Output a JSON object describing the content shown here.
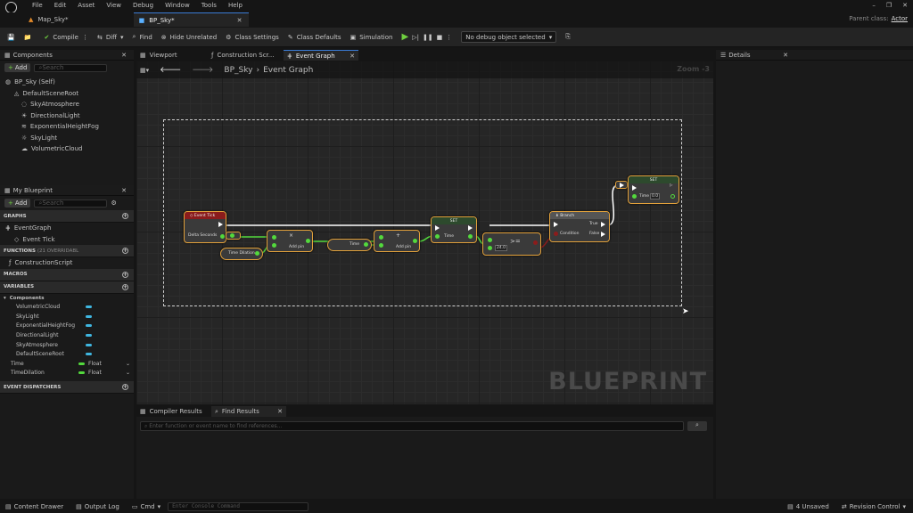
{
  "menu": [
    "File",
    "Edit",
    "Asset",
    "View",
    "Debug",
    "Window",
    "Tools",
    "Help"
  ],
  "tabs": [
    {
      "label": "Map_Sky*"
    },
    {
      "label": "BP_Sky*"
    }
  ],
  "parent_class_label": "Parent class:",
  "parent_class": "Actor",
  "toolbar": {
    "compile": "Compile",
    "diff": "Diff",
    "find": "Find",
    "hide_unrelated": "Hide Unrelated",
    "class_settings": "Class Settings",
    "class_defaults": "Class Defaults",
    "simulation": "Simulation",
    "debug_object": "No debug object selected"
  },
  "components_panel": {
    "title": "Components",
    "add": "Add",
    "search": "Search",
    "items": [
      {
        "label": "BP_Sky (Self)"
      },
      {
        "label": "DefaultSceneRoot"
      },
      {
        "label": "SkyAtmosphere"
      },
      {
        "label": "DirectionalLight"
      },
      {
        "label": "ExponentialHeightFog"
      },
      {
        "label": "SkyLight"
      },
      {
        "label": "VolumetricCloud"
      }
    ]
  },
  "my_blueprint": {
    "title": "My Blueprint",
    "add": "Add",
    "search": "Search",
    "graphs": "GRAPHS",
    "event_graph": "EventGraph",
    "event_tick": "Event Tick",
    "functions": "FUNCTIONS",
    "functions_count": "(21 OVERRIDABL",
    "construction_script": "ConstructionScript",
    "macros": "MACROS",
    "variables": "VARIABLES",
    "components": "Components",
    "component_vars": [
      "VolumetricCloud",
      "SkyLight",
      "ExponentialHeightFog",
      "DirectionalLight",
      "SkyAtmosphere",
      "DefaultSceneRoot"
    ],
    "float_vars": [
      {
        "name": "Time",
        "type": "Float"
      },
      {
        "name": "TimeDilation",
        "type": "Float"
      }
    ],
    "event_dispatchers": "EVENT DISPATCHERS"
  },
  "editor_tabs": [
    "Viewport",
    "Construction Scr...",
    "Event Graph"
  ],
  "breadcrumb": {
    "blueprint": "BP_Sky",
    "graph": "Event Graph"
  },
  "zoom": "Zoom -3",
  "watermark": "BLUEPRINT",
  "nodes": {
    "event_tick": "Event Tick",
    "delta_seconds": "Delta Seconds",
    "time_dilation": "Time Dilation",
    "add_pin": "Add pin",
    "time": "Time",
    "set": "SET",
    "branch": "Branch",
    "condition": "Condition",
    "true": "True",
    "false": "False",
    "gte": ">=",
    "value": "24.0",
    "reset": "0.0"
  },
  "bottom_tabs": [
    "Compiler Results",
    "Find Results"
  ],
  "find_placeholder": "Enter function or event name to find references...",
  "details": {
    "title": "Details"
  },
  "statusbar": {
    "content_drawer": "Content Drawer",
    "output_log": "Output Log",
    "cmd": "Cmd",
    "console_placeholder": "Enter Console Command",
    "unsaved": "4 Unsaved",
    "revision_control": "Revision Control"
  },
  "colors": {
    "accent": "#3a7bd5",
    "float_pin": "#53d93d",
    "node_border": "#e2a13b",
    "event_header": "#8b1c1c"
  }
}
